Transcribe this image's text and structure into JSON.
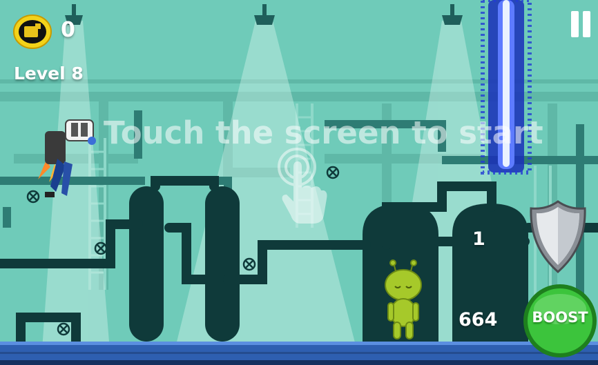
{
  "hud": {
    "coin_count": "0",
    "level_label": "Level 8",
    "start_prompt": "Touch the screen to start",
    "shield_count": "1",
    "distance_value": "664",
    "boost_label": "BOOST"
  },
  "icons": {
    "coin": "coin-icon",
    "pause": "pause-icon",
    "shield": "shield-icon",
    "touch": "tap-hand-icon",
    "boost": "boost-button"
  },
  "colors": {
    "background": "#6fcbb9",
    "pipes": "#1f5f5b",
    "tanks": "#0f3a3a",
    "floor": "#2e5fb0",
    "boost": "#2fa82f",
    "laser": "#2b3fd8",
    "coin": "#f3d21a"
  }
}
